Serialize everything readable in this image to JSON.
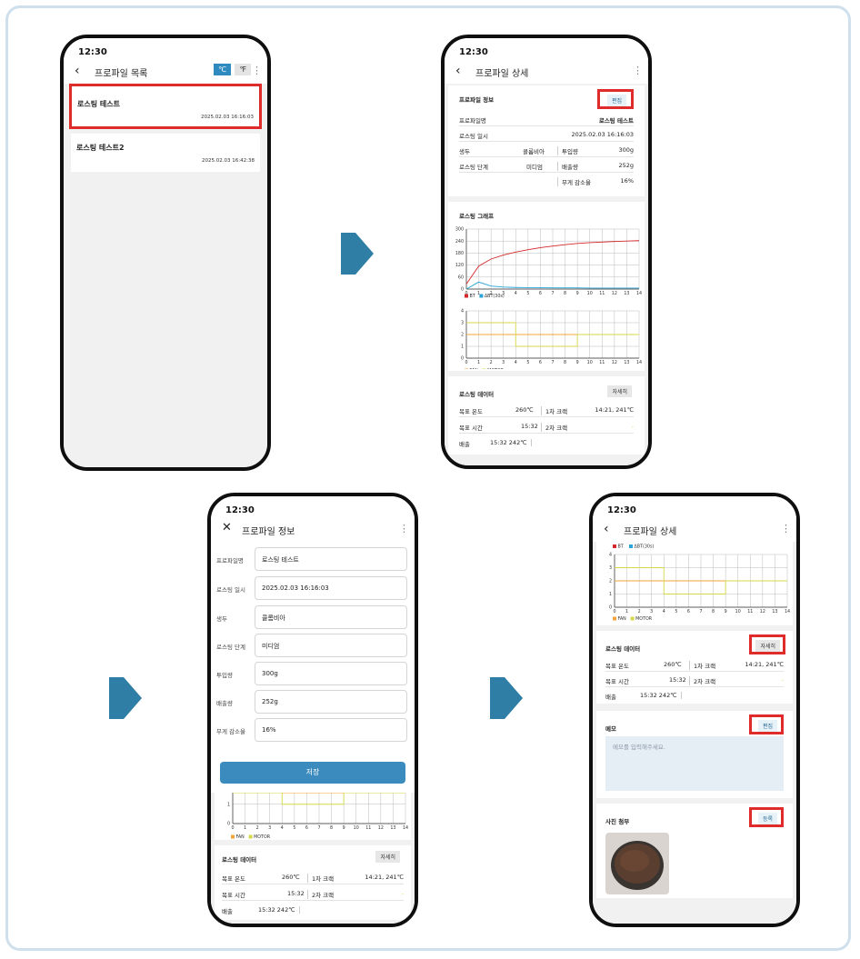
{
  "colors": {
    "accent": "#2f8abf",
    "highlight": "#e02b2b",
    "bt": "#d4282a",
    "dbt": "#2aa4d8",
    "fan": "#f2a33a",
    "motor": "#d4d94a",
    "arrow": "#2f7ea5"
  },
  "phone1": {
    "time": "12:30",
    "title": "프로파일 목록",
    "unit_c": "℃",
    "unit_f": "℉",
    "profiles": [
      {
        "name": "로스팅 테스트",
        "date": "2025.02.03 16:16:03"
      },
      {
        "name": "로스팅 테스트2",
        "date": "2025.02.03 16:42:38"
      }
    ]
  },
  "phone2": {
    "time": "12:30",
    "title": "프로파일 상세",
    "info_title": "프로파일 정보",
    "edit_label": "편집",
    "rows": {
      "profile_name_label": "프로파일명",
      "profile_name_value": "로스팅 테스트",
      "roast_date_label": "로스팅 일시",
      "roast_date_value": "2025.02.03 16:16:03",
      "bean_label": "생두",
      "bean_value": "콜롬비아",
      "input_label": "투입량",
      "input_value": "300g",
      "stage_label": "로스팅 단계",
      "stage_value": "미디엄",
      "output_label": "배출량",
      "output_value": "252g",
      "loss_label": "무게 감소율",
      "loss_value": "16%"
    },
    "graph_title": "로스팅 그래프",
    "data_title": "로스팅 데이터",
    "detail_label": "자세히",
    "target_temp_label": "목표 온도",
    "target_temp_value": "260℃",
    "crack1_label": "1차 크랙",
    "crack1_value": "14:21, 241℃",
    "target_time_label": "목표 시간",
    "target_time_value": "15:32",
    "crack2_label": "2차 크랙",
    "crack2_value": "-",
    "discharge_label": "배출",
    "discharge_value": "15:32 242℃"
  },
  "phone3": {
    "time": "12:30",
    "title": "프로파일 정보",
    "fields": [
      {
        "label": "프로파일명",
        "value": "로스팅 테스트"
      },
      {
        "label": "로스팅 일시",
        "value": "2025.02.03 16:16:03"
      },
      {
        "label": "생두",
        "value": "콜롬비아"
      },
      {
        "label": "로스팅 단계",
        "value": "미디엄"
      },
      {
        "label": "투입량",
        "value": "300g"
      },
      {
        "label": "배출량",
        "value": "252g"
      },
      {
        "label": "무게 감소율",
        "value": "16%"
      }
    ],
    "save_label": "저장"
  },
  "phone4": {
    "time": "12:30",
    "title": "프로파일 상세",
    "memo_title": "메모",
    "memo_placeholder": "메모를 입력해주세요.",
    "photo_title": "사진 첨부",
    "register_label": "등록"
  },
  "legends": {
    "bt": "BT",
    "dbt": "ΔBT(30s)",
    "fan": "FAN",
    "motor": "MOTOR"
  },
  "chart_data": [
    {
      "type": "line",
      "title": "로스팅 그래프",
      "x": [
        0,
        1,
        2,
        3,
        4,
        5,
        6,
        7,
        8,
        9,
        10,
        11,
        12,
        13,
        14
      ],
      "xlim": [
        0,
        14
      ],
      "ylim": [
        0,
        300
      ],
      "yticks": [
        0,
        60,
        120,
        180,
        240,
        300
      ],
      "series": [
        {
          "name": "BT",
          "values": [
            25,
            115,
            150,
            170,
            185,
            197,
            207,
            215,
            222,
            228,
            232,
            235,
            238,
            240,
            242
          ]
        },
        {
          "name": "ΔBT(30s)",
          "values": [
            0,
            35,
            15,
            10,
            8,
            7,
            7,
            6,
            6,
            6,
            5,
            5,
            5,
            5,
            5
          ]
        }
      ],
      "grid": true,
      "legend": "bottom-left"
    },
    {
      "type": "line",
      "x": [
        0,
        1,
        2,
        3,
        4,
        5,
        6,
        7,
        8,
        9,
        10,
        11,
        12,
        13,
        14
      ],
      "xlim": [
        0,
        14
      ],
      "ylim": [
        0,
        4
      ],
      "yticks": [
        0,
        1,
        2,
        3,
        4
      ],
      "series": [
        {
          "name": "FAN",
          "values": [
            2,
            2,
            2,
            2,
            2,
            2,
            2,
            2,
            2,
            2,
            2,
            2,
            2,
            2,
            2
          ]
        },
        {
          "name": "MOTOR",
          "values": [
            3,
            3,
            3,
            3,
            1,
            1,
            1,
            1,
            1,
            2,
            2,
            2,
            2,
            2,
            2
          ]
        }
      ],
      "grid": true,
      "legend": "bottom-left"
    }
  ]
}
